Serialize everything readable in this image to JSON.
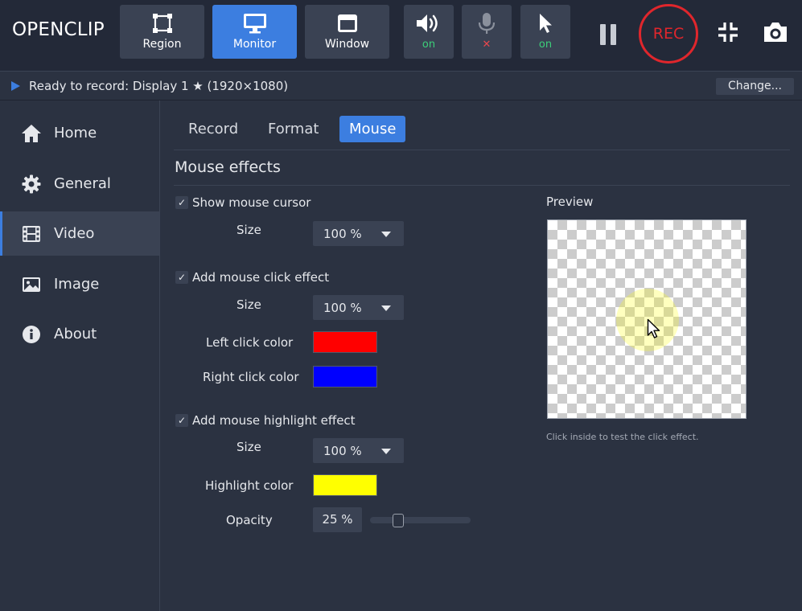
{
  "app": {
    "title": "OPENCLIP"
  },
  "toolbar": {
    "modes": [
      {
        "label": "Region",
        "icon": "region-icon",
        "active": false
      },
      {
        "label": "Monitor",
        "icon": "monitor-icon",
        "active": true
      },
      {
        "label": "Window",
        "icon": "window-icon",
        "active": false
      }
    ],
    "toggles": {
      "speaker": {
        "icon": "speaker-icon",
        "state": "on"
      },
      "microphone": {
        "icon": "microphone-icon",
        "state": "✕"
      },
      "cursor": {
        "icon": "cursor-icon",
        "state": "on"
      }
    },
    "rec_label": "REC",
    "accent": "#3c7ee0",
    "rec_color": "#e0262c"
  },
  "status": {
    "text": "Ready to record: Display 1 ★ (1920×1080)",
    "change_label": "Change..."
  },
  "sidebar": {
    "items": [
      {
        "label": "Home",
        "icon": "home-icon",
        "active": false
      },
      {
        "label": "General",
        "icon": "gear-icon",
        "active": false
      },
      {
        "label": "Video",
        "icon": "film-icon",
        "active": true
      },
      {
        "label": "Image",
        "icon": "image-icon",
        "active": false
      },
      {
        "label": "About",
        "icon": "info-icon",
        "active": false
      }
    ]
  },
  "tabs": [
    {
      "label": "Record",
      "active": false
    },
    {
      "label": "Format",
      "active": false
    },
    {
      "label": "Mouse",
      "active": true
    }
  ],
  "mouse": {
    "section_title": "Mouse effects",
    "show_cursor": {
      "label": "Show mouse cursor",
      "checked": true,
      "size_label": "Size",
      "size_value": "100 %"
    },
    "click_effect": {
      "label": "Add mouse click effect",
      "checked": true,
      "size_label": "Size",
      "size_value": "100 %",
      "left_label": "Left click color",
      "left_color": "#ff0000",
      "right_label": "Right click color",
      "right_color": "#0000ff"
    },
    "highlight": {
      "label": "Add mouse highlight effect",
      "checked": true,
      "size_label": "Size",
      "size_value": "100 %",
      "color_label": "Highlight color",
      "color": "#ffff00",
      "opacity_label": "Opacity",
      "opacity_value": "25 %",
      "opacity_fraction": 0.25
    },
    "preview": {
      "label": "Preview",
      "hint": "Click inside to test the click effect."
    }
  }
}
